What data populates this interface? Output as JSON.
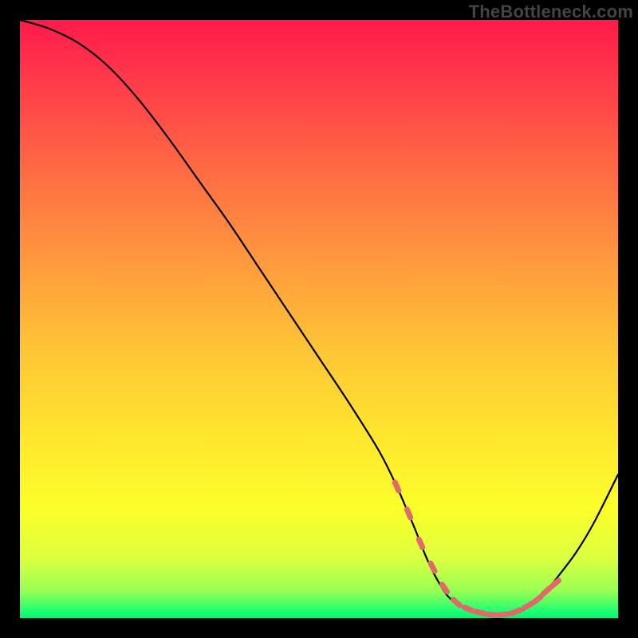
{
  "watermark": "TheBottleneck.com",
  "gradient": {
    "stops": [
      {
        "offset": 0.0,
        "color": "#ff1a4b"
      },
      {
        "offset": 0.1,
        "color": "#ff3a4a"
      },
      {
        "offset": 0.25,
        "color": "#ff6a44"
      },
      {
        "offset": 0.4,
        "color": "#ff983e"
      },
      {
        "offset": 0.55,
        "color": "#ffc436"
      },
      {
        "offset": 0.7,
        "color": "#ffe72e"
      },
      {
        "offset": 0.82,
        "color": "#fbff2a"
      },
      {
        "offset": 0.9,
        "color": "#dcff40"
      },
      {
        "offset": 0.955,
        "color": "#97ff55"
      },
      {
        "offset": 0.985,
        "color": "#2bff6e"
      },
      {
        "offset": 1.0,
        "color": "#00f57a"
      }
    ]
  },
  "chart_data": {
    "type": "line",
    "title": "",
    "xlabel": "",
    "ylabel": "",
    "xlim": [
      0,
      100
    ],
    "ylim": [
      0,
      100
    ],
    "note": "Bottleneck-style curve; y≈100 means worst (red/top), y≈0 means best (green/bottom). Minimum around x≈70–82.",
    "series": [
      {
        "name": "curve",
        "x": [
          0,
          5,
          10,
          15,
          20,
          25,
          30,
          35,
          40,
          45,
          50,
          55,
          60,
          63,
          66,
          68,
          70,
          72,
          75,
          78,
          80,
          82,
          84,
          86,
          88,
          90,
          93,
          96,
          100
        ],
        "y": [
          100,
          98.5,
          96,
          92,
          86.5,
          80,
          73,
          66,
          58.5,
          51,
          43.5,
          36,
          28,
          22,
          15,
          10,
          6,
          3.2,
          1.5,
          0.7,
          0.5,
          0.7,
          1.3,
          2.5,
          4.5,
          7,
          11,
          16,
          24
        ]
      }
    ],
    "highlight_segment": {
      "name": "bottom-dotted",
      "color": "#e06a6a",
      "points_x": [
        63,
        65,
        67,
        69,
        71,
        73,
        75,
        77,
        79,
        81,
        83,
        85,
        86.5,
        88,
        89.5
      ],
      "points_y": [
        22,
        17.5,
        12.5,
        8.5,
        5,
        2.6,
        1.5,
        0.9,
        0.55,
        0.6,
        1.1,
        2.1,
        3.1,
        4.5,
        5.8
      ]
    }
  }
}
